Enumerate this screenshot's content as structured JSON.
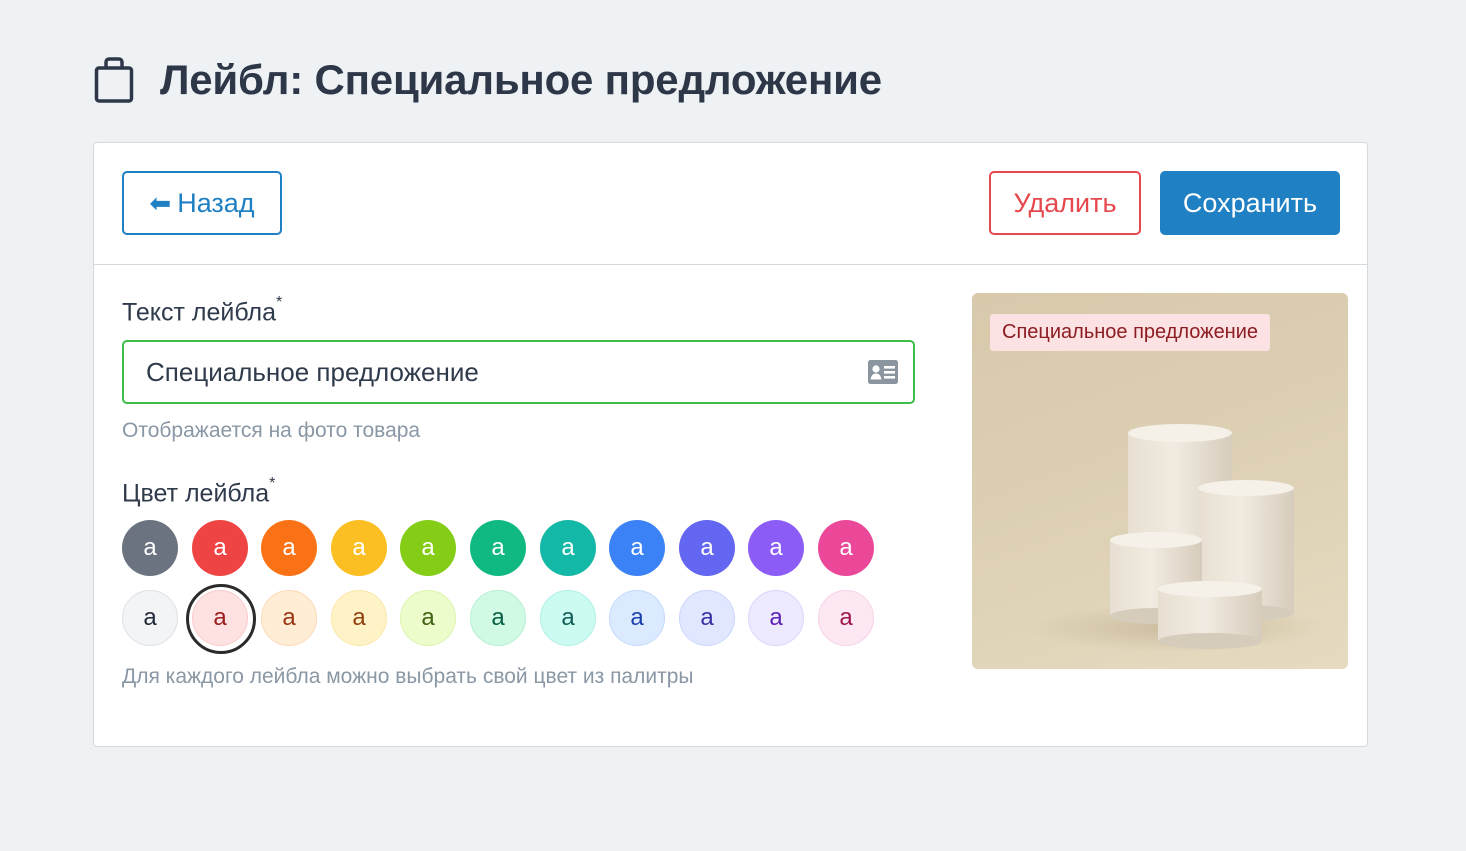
{
  "page": {
    "title": "Лейбл: Специальное предложение",
    "icon": "shopping-bag-icon"
  },
  "toolbar": {
    "back_label": "Назад",
    "delete_label": "Удалить",
    "save_label": "Сохранить",
    "colors": {
      "primary": "#1f80c3",
      "danger": "#e5484d"
    }
  },
  "form": {
    "label_text": {
      "label": "Текст лейбла",
      "required_mark": "*",
      "value": "Специальное предложение",
      "hint": "Отображается на фото товара",
      "focus_color": "#3dbd4a"
    },
    "label_color": {
      "label": "Цвет лейбла",
      "required_mark": "*",
      "hint": "Для каждого лейбла можно выбрать свой цвет из палитры",
      "selected": "light-red",
      "swatches_dark": [
        {
          "id": "gray",
          "letter": "a",
          "bg": "#6b7280",
          "fg": "#ffffff"
        },
        {
          "id": "red",
          "letter": "a",
          "bg": "#ef4444",
          "fg": "#ffffff"
        },
        {
          "id": "orange",
          "letter": "a",
          "bg": "#f97316",
          "fg": "#ffffff"
        },
        {
          "id": "amber",
          "letter": "a",
          "bg": "#fbbf24",
          "fg": "#ffffff"
        },
        {
          "id": "lime",
          "letter": "a",
          "bg": "#84cc16",
          "fg": "#ffffff"
        },
        {
          "id": "emerald",
          "letter": "a",
          "bg": "#10b981",
          "fg": "#ffffff"
        },
        {
          "id": "teal",
          "letter": "a",
          "bg": "#14b8a6",
          "fg": "#ffffff"
        },
        {
          "id": "blue",
          "letter": "a",
          "bg": "#3b82f6",
          "fg": "#ffffff"
        },
        {
          "id": "indigo",
          "letter": "a",
          "bg": "#6366f1",
          "fg": "#ffffff"
        },
        {
          "id": "violet",
          "letter": "a",
          "bg": "#8b5cf6",
          "fg": "#ffffff"
        },
        {
          "id": "pink",
          "letter": "a",
          "bg": "#ec4899",
          "fg": "#ffffff"
        }
      ],
      "swatches_light": [
        {
          "id": "light-gray",
          "letter": "a",
          "bg": "#f3f4f6",
          "fg": "#1f2937",
          "border": "#dde1e6"
        },
        {
          "id": "light-red",
          "letter": "a",
          "bg": "#fee2e2",
          "fg": "#991b1b",
          "border": "#fccaca"
        },
        {
          "id": "light-orange",
          "letter": "a",
          "bg": "#ffedd5",
          "fg": "#9a3412",
          "border": "#fdd9b5"
        },
        {
          "id": "light-amber",
          "letter": "a",
          "bg": "#fef3c7",
          "fg": "#92400e",
          "border": "#fce7a6"
        },
        {
          "id": "light-lime",
          "letter": "a",
          "bg": "#ecfccb",
          "fg": "#3f6212",
          "border": "#dcf5ae"
        },
        {
          "id": "light-emerald",
          "letter": "a",
          "bg": "#d1fae5",
          "fg": "#065f46",
          "border": "#b6f0d2"
        },
        {
          "id": "light-teal",
          "letter": "a",
          "bg": "#ccfbf1",
          "fg": "#115e59",
          "border": "#b0f0e3"
        },
        {
          "id": "light-blue",
          "letter": "a",
          "bg": "#dbeafe",
          "fg": "#1e40af",
          "border": "#c2dafc"
        },
        {
          "id": "light-indigo",
          "letter": "a",
          "bg": "#e0e7ff",
          "fg": "#3730a3",
          "border": "#ccd6fc"
        },
        {
          "id": "light-violet",
          "letter": "a",
          "bg": "#ede9fe",
          "fg": "#5b21b6",
          "border": "#ddd5fb"
        },
        {
          "id": "light-pink",
          "letter": "a",
          "bg": "#fce7f3",
          "fg": "#9d174d",
          "border": "#f8d2e7"
        }
      ]
    }
  },
  "preview": {
    "badge_text": "Специальное предложение",
    "badge_bg": "#fde2e3",
    "badge_fg": "#8c1d23"
  }
}
